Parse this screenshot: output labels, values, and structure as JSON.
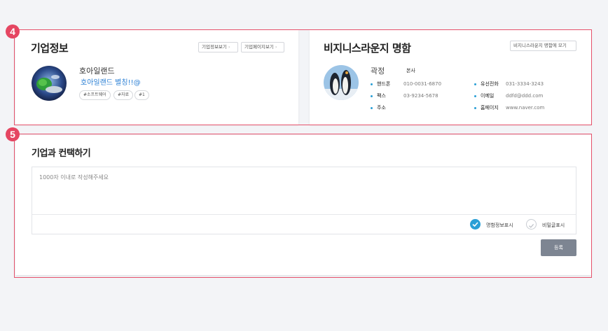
{
  "markers": {
    "company": "4",
    "contact": "5"
  },
  "company_info": {
    "title": "기업정보",
    "buttons": [
      "기업정보보기",
      "기업페이지보기"
    ],
    "name": "호아일랜드",
    "alias": "호아일랜드 별칭!!@",
    "tags": [
      "#소프트웨어",
      "#자료",
      "#1"
    ],
    "avatar_icon": "planet-icon"
  },
  "business_card": {
    "title": "비지니스라운지 명함",
    "button": "비지니스라운지 명함에 모기",
    "person_name": "곽정",
    "department": "본사",
    "photo_icon": "penguin-photo",
    "rows_left": [
      {
        "label": "핸드폰",
        "value": "010-0031-6870"
      },
      {
        "label": "팩스",
        "value": "03-9234-5678"
      },
      {
        "label": "주소",
        "value": ""
      }
    ],
    "rows_right": [
      {
        "label": "유선전화",
        "value": "031-3334-3243"
      },
      {
        "label": "이메일",
        "value": "ddfd@ddd.com"
      },
      {
        "label": "홈페이지",
        "value": "www.naver.com"
      }
    ]
  },
  "contact_form": {
    "title": "기업과 컨택하기",
    "placeholder": "1000자 이내로 작성해주세요",
    "options": [
      {
        "label": "명함정보표시",
        "checked": true
      },
      {
        "label": "비밀글표시",
        "checked": false
      }
    ],
    "submit_label": "등록"
  },
  "colors": {
    "accent": "#2a9fd6",
    "marker": "#e54662",
    "submit": "#7d8592",
    "link": "#2a7fd4"
  }
}
